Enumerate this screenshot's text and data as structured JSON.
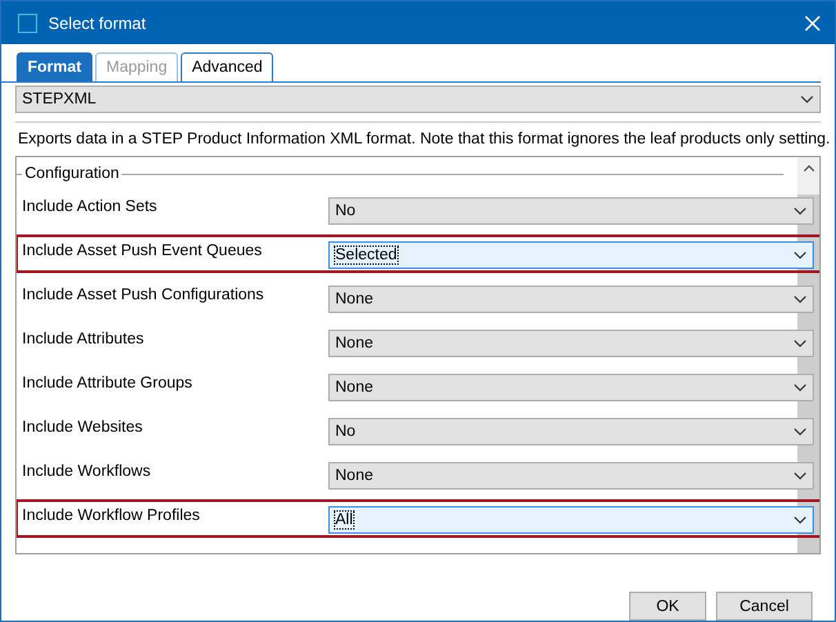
{
  "window": {
    "title": "Select format"
  },
  "tabs": [
    {
      "label": "Format",
      "selected": true,
      "disabled": false
    },
    {
      "label": "Mapping",
      "selected": false,
      "disabled": true
    },
    {
      "label": "Advanced",
      "selected": false,
      "disabled": false
    }
  ],
  "format_select": {
    "value": "STEPXML"
  },
  "description": "Exports data in a STEP Product Information XML format. Note that this format ignores the leaf products only setting.",
  "configuration": {
    "title": "Configuration",
    "rows": [
      {
        "label": "Include Action Sets",
        "value": "No",
        "highlighted": false
      },
      {
        "label": "Include Asset Push Event Queues",
        "value": "Selected",
        "highlighted": true
      },
      {
        "label": "Include Asset Push Configurations",
        "value": "None",
        "highlighted": false
      },
      {
        "label": "Include Attributes",
        "value": "None",
        "highlighted": false
      },
      {
        "label": "Include Attribute Groups",
        "value": "None",
        "highlighted": false
      },
      {
        "label": "Include Websites",
        "value": "No",
        "highlighted": false
      },
      {
        "label": "Include Workflows",
        "value": "None",
        "highlighted": false
      },
      {
        "label": "Include Workflow Profiles",
        "value": "All",
        "highlighted": true
      }
    ]
  },
  "buttons": [
    {
      "label": "OK"
    },
    {
      "label": "Cancel"
    }
  ]
}
